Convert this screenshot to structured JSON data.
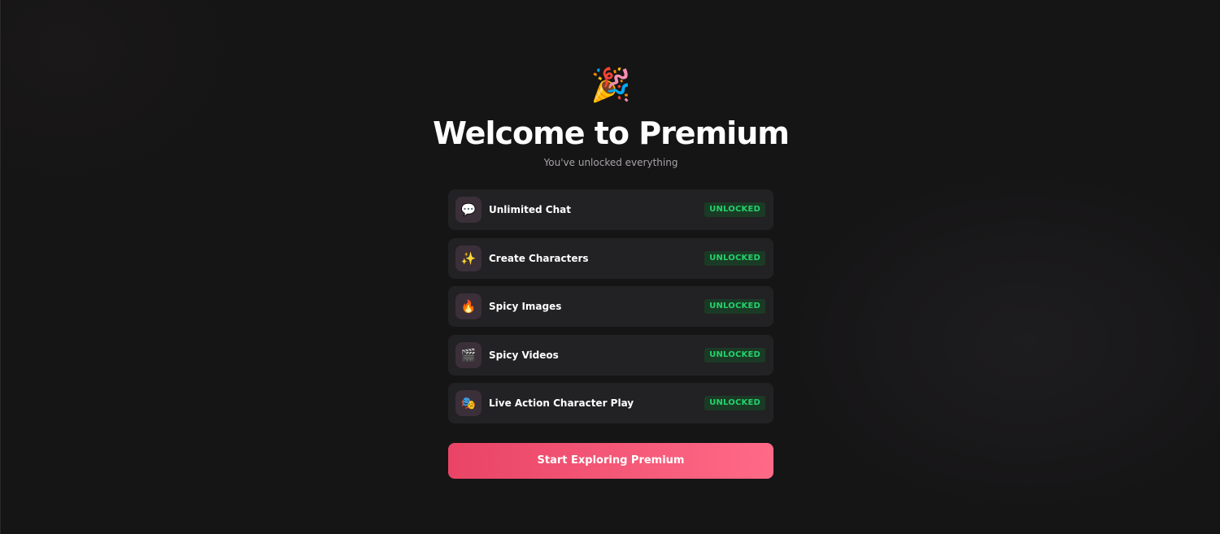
{
  "header": {
    "emoji": "🎉",
    "title": "Welcome to Premium",
    "subtitle": "You've unlocked everything"
  },
  "features": [
    {
      "icon": "💬",
      "icon_name": "speech-bubble-icon",
      "label": "Unlimited Chat",
      "status": "UNLOCKED"
    },
    {
      "icon": "✨",
      "icon_name": "sparkles-icon",
      "label": "Create Characters",
      "status": "UNLOCKED"
    },
    {
      "icon": "🔥",
      "icon_name": "fire-icon",
      "label": "Spicy Images",
      "status": "UNLOCKED"
    },
    {
      "icon": "🎬",
      "icon_name": "clapperboard-icon",
      "label": "Spicy Videos",
      "status": "UNLOCKED"
    },
    {
      "icon": "🎭",
      "icon_name": "theater-masks-icon",
      "label": "Live Action Character Play",
      "status": "UNLOCKED"
    }
  ],
  "cta": {
    "label": "Start Exploring Premium"
  },
  "colors": {
    "background": "#161516",
    "card": "#222123",
    "badge_text": "#22d36a",
    "badge_bg": "#1b3a26",
    "cta_start": "#e94466",
    "cta_end": "#ff6a87"
  }
}
